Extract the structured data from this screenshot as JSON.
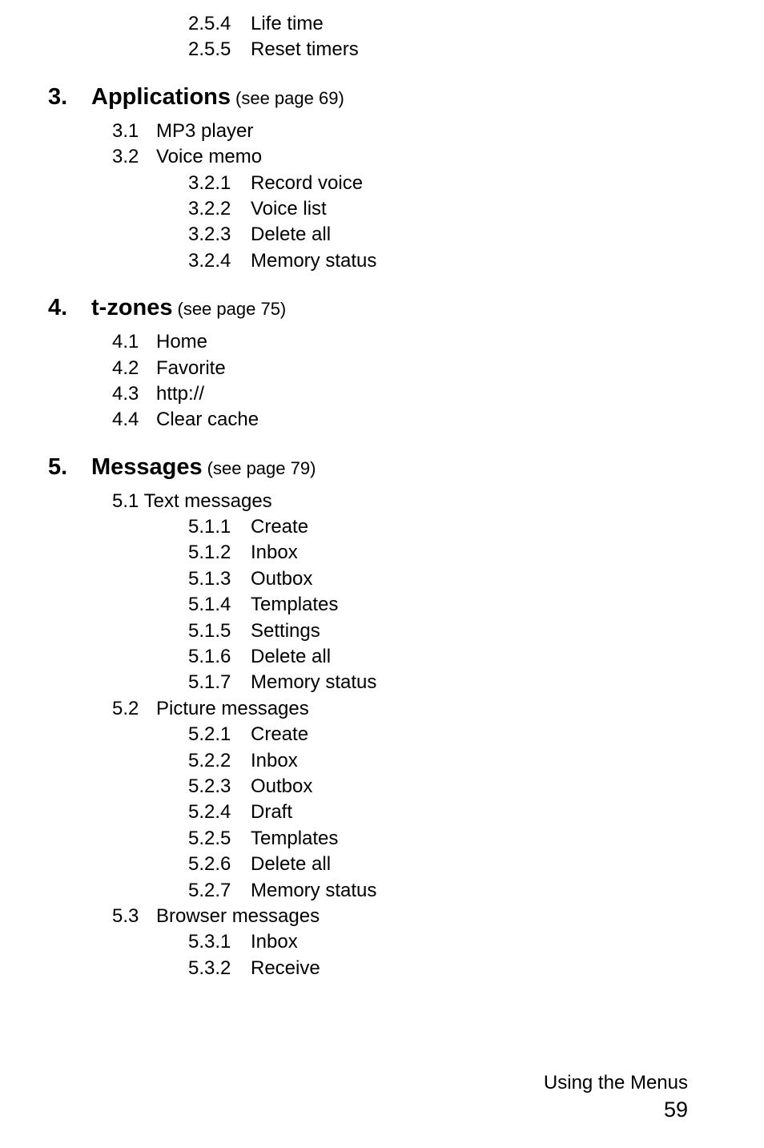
{
  "top_items": [
    {
      "num": "2.5.4",
      "label": "Life time"
    },
    {
      "num": "2.5.5",
      "label": "Reset timers"
    }
  ],
  "sections": [
    {
      "num": "3.",
      "title": "Applications",
      "ref": "(see page 69)",
      "subs": [
        {
          "num": "3.1",
          "label": "MP3 player"
        },
        {
          "num": "3.2",
          "label": "Voice memo",
          "children": [
            {
              "num": "3.2.1",
              "label": "Record voice"
            },
            {
              "num": "3.2.2",
              "label": "Voice list"
            },
            {
              "num": "3.2.3",
              "label": "Delete all"
            },
            {
              "num": "3.2.4",
              "label": "Memory status"
            }
          ]
        }
      ]
    },
    {
      "num": "4.",
      "title": "t-zones",
      "ref": "(see page 75)",
      "subs": [
        {
          "num": "4.1",
          "label": "Home"
        },
        {
          "num": "4.2",
          "label": "Favorite"
        },
        {
          "num": "4.3",
          "label": "http://"
        },
        {
          "num": "4.4",
          "label": "Clear cache"
        }
      ]
    },
    {
      "num": "5.",
      "title": "Messages",
      "ref": "(see page 79)",
      "subs": [
        {
          "num": "5.1",
          "label": "Text messages",
          "tight": true,
          "children": [
            {
              "num": "5.1.1",
              "label": "Create"
            },
            {
              "num": "5.1.2",
              "label": "Inbox"
            },
            {
              "num": "5.1.3",
              "label": "Outbox"
            },
            {
              "num": "5.1.4",
              "label": "Templates"
            },
            {
              "num": "5.1.5",
              "label": "Settings"
            },
            {
              "num": "5.1.6",
              "label": "Delete all"
            },
            {
              "num": "5.1.7",
              "label": "Memory status"
            }
          ]
        },
        {
          "num": "5.2",
          "label": "Picture messages",
          "children": [
            {
              "num": "5.2.1",
              "label": "Create"
            },
            {
              "num": "5.2.2",
              "label": "Inbox"
            },
            {
              "num": "5.2.3",
              "label": "Outbox"
            },
            {
              "num": "5.2.4",
              "label": "Draft"
            },
            {
              "num": "5.2.5",
              "label": "Templates"
            },
            {
              "num": "5.2.6",
              "label": "Delete all"
            },
            {
              "num": "5.2.7",
              "label": "Memory status"
            }
          ]
        },
        {
          "num": "5.3",
          "label": "Browser messages",
          "children": [
            {
              "num": "5.3.1",
              "label": "Inbox"
            },
            {
              "num": "5.3.2",
              "label": "Receive"
            }
          ]
        }
      ]
    }
  ],
  "footer": {
    "text": "Using the Menus",
    "page": "59"
  }
}
